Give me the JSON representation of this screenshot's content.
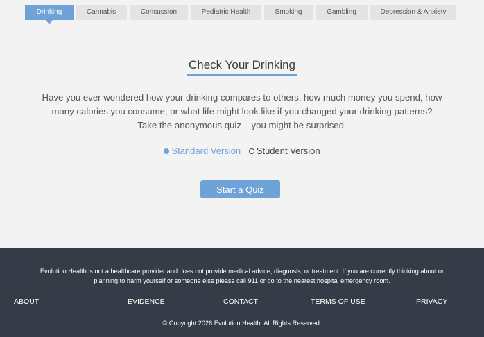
{
  "tabs": [
    {
      "label": "Drinking",
      "active": true
    },
    {
      "label": "Cannabis",
      "active": false
    },
    {
      "label": "Concussion",
      "active": false
    },
    {
      "label": "Pediatric Health",
      "active": false
    },
    {
      "label": "Smoking",
      "active": false
    },
    {
      "label": "Gambling",
      "active": false
    },
    {
      "label": "Depression & Anxiety",
      "active": false
    }
  ],
  "main": {
    "title": "Check Your Drinking",
    "description": "Have you ever wondered how your drinking compares to others, how much money you spend, how many calories you consume, or what life might look like if you changed your drinking patterns? Take the anonymous quiz – you might be surprised.",
    "versions": [
      {
        "label": "Standard Version",
        "selected": true
      },
      {
        "label": "Student Version",
        "selected": false
      }
    ],
    "cta_label": "Start a Quiz"
  },
  "footer": {
    "disclaimer": "Evolution Health is not a healthcare provider and does not provide medical advice, diagnosis, or treatment. If you are currently thinking about or planning to harm yourself or someone else please call 911 or go to the nearest hospital emergency room.",
    "links": [
      "ABOUT",
      "EVIDENCE",
      "CONTACT",
      "TERMS OF USE",
      "PRIVACY"
    ],
    "copyright": "© Copyright 2026 Evolution Health. All Rights Reserved."
  },
  "colors": {
    "accent": "#6fa3d8",
    "tab_bg": "#e4e4e4",
    "footer_bg": "#363c47",
    "page_bg": "#f3f3f3"
  }
}
